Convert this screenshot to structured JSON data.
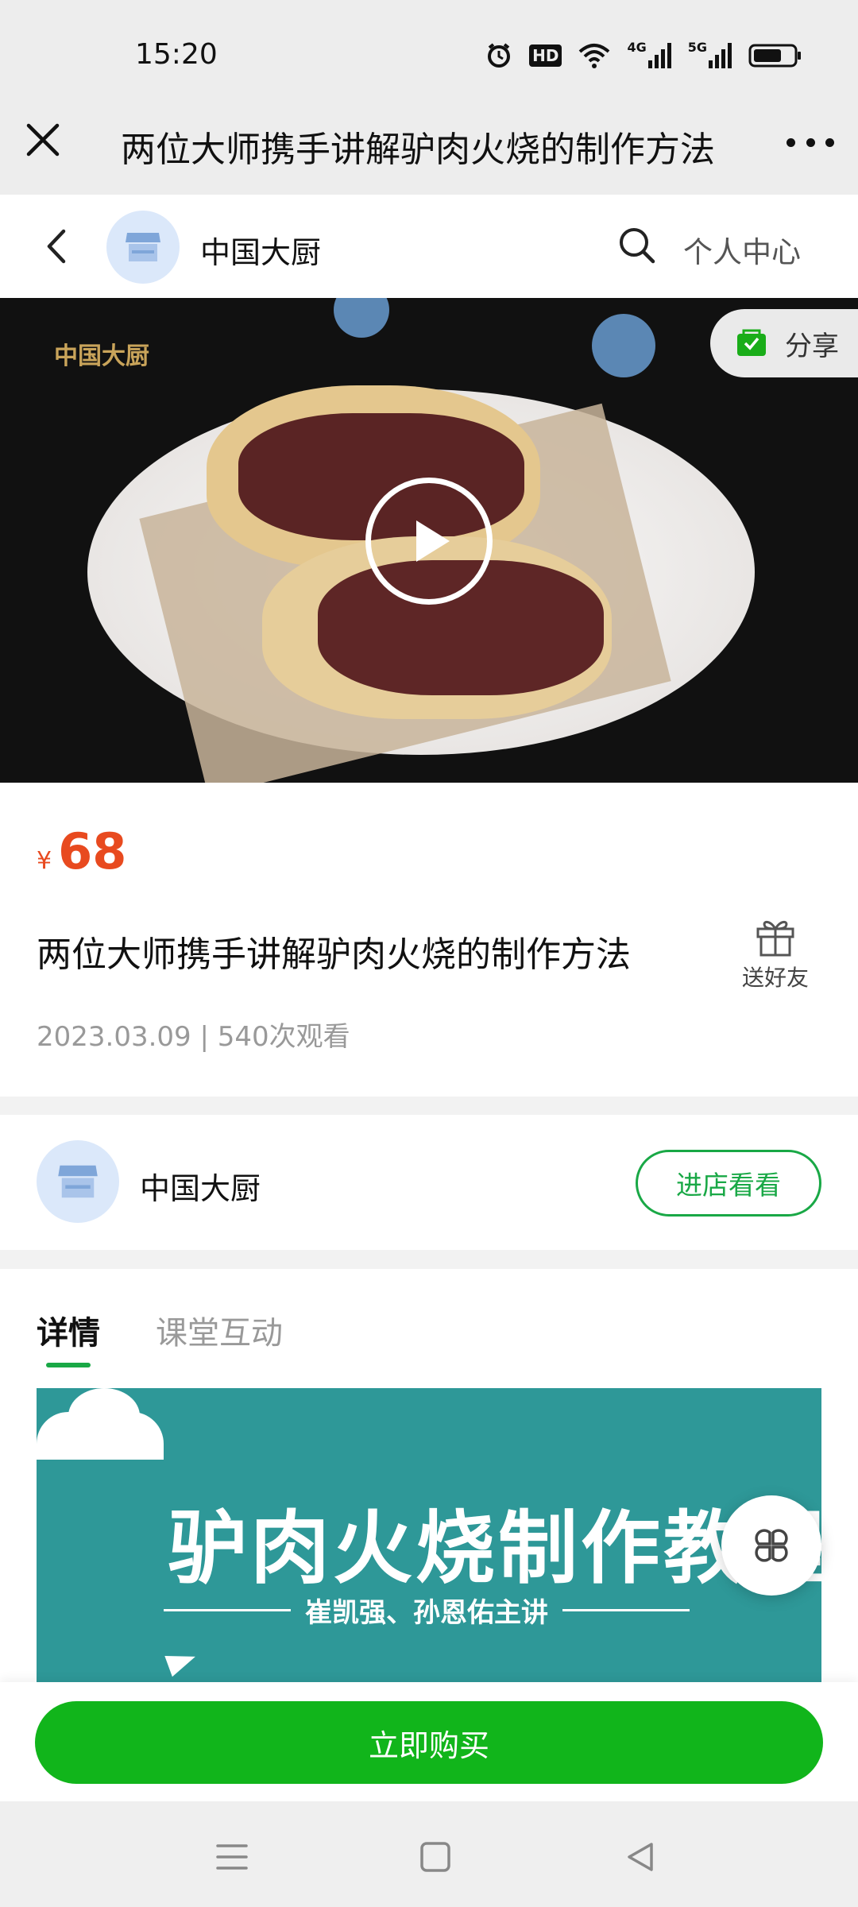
{
  "status_bar": {
    "time": "15:20",
    "icons": [
      "alarm-icon",
      "hd-icon",
      "wifi-icon",
      "signal-4g-icon",
      "signal-5g-icon",
      "battery-icon"
    ],
    "hd_label": "HD",
    "net1": "4G",
    "net2": "5G"
  },
  "title_bar": {
    "title": "两位大师携手讲解驴肉火烧的制作方法"
  },
  "shop_nav": {
    "shop_name": "中国大厨",
    "personal_center": "个人中心"
  },
  "video": {
    "watermark": "中国大厨",
    "share_label": "分享"
  },
  "product": {
    "currency": "¥",
    "price": "68",
    "title": "两位大师携手讲解驴肉火烧的制作方法",
    "gift_label": "送好友",
    "meta": "2023.03.09 | 540次观看"
  },
  "shop_card": {
    "name": "中国大厨",
    "visit_label": "进店看看"
  },
  "detail": {
    "tabs": [
      {
        "label": "详情",
        "active": true
      },
      {
        "label": "课堂互动",
        "active": false
      }
    ],
    "banner_title": "驴肉火烧制作教程",
    "banner_subtitle": "崔凯强、孙恩佑主讲"
  },
  "buy_bar": {
    "buy_label": "立即购买"
  },
  "colors": {
    "accent_green": "#19a846",
    "buy_green": "#11b51b",
    "price_red": "#e84a1f",
    "banner_teal": "#2e9898"
  }
}
